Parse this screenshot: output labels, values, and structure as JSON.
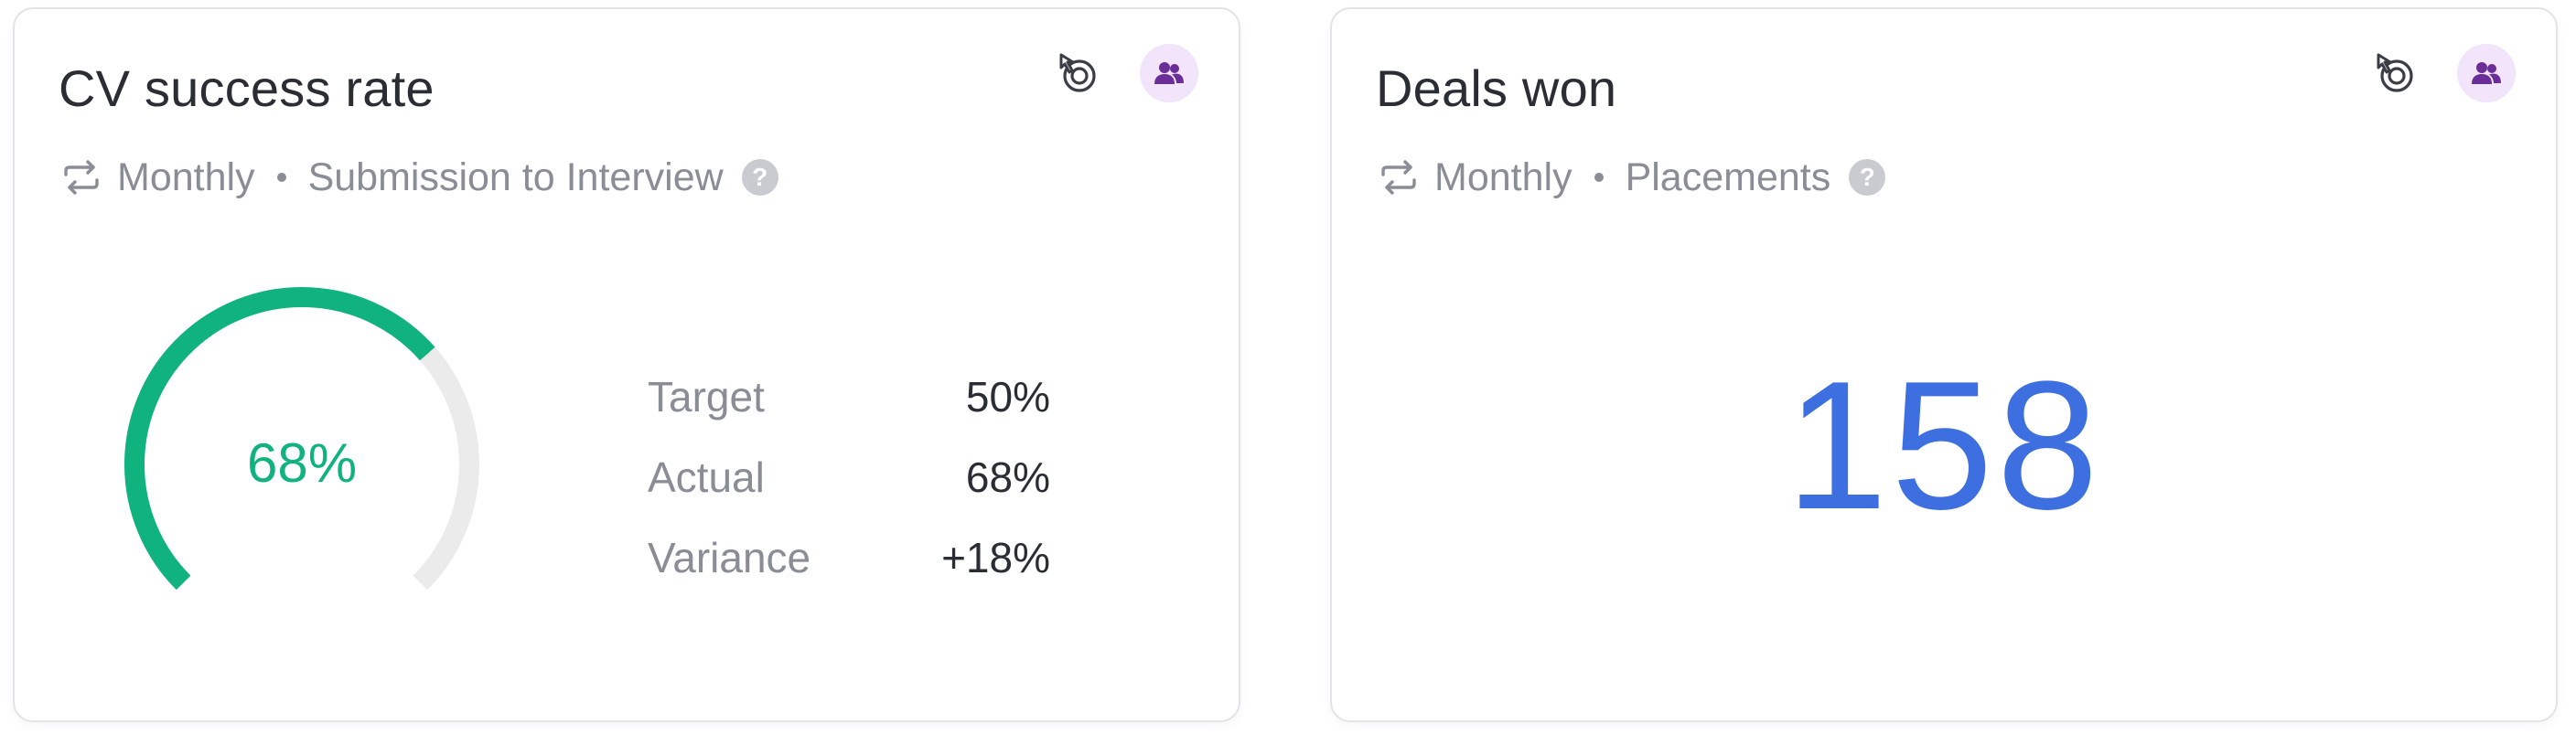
{
  "cards": [
    {
      "title": "CV success rate",
      "period": "Monthly",
      "stage": "Submission to Interview",
      "help_icon": "help-icon",
      "gauge": {
        "value": 68,
        "display": "68%",
        "color": "#10b37d",
        "track_color": "#ebebec"
      },
      "stats": [
        {
          "label": "Target",
          "value": "50%"
        },
        {
          "label": "Actual",
          "value": "68%"
        },
        {
          "label": "Variance",
          "value": "+18%"
        }
      ]
    },
    {
      "title": "Deals won",
      "period": "Monthly",
      "stage": "Placements",
      "help_icon": "help-icon",
      "metric": "158",
      "metric_color": "#3d6fe0"
    }
  ],
  "help_glyph": "?",
  "colors": {
    "muted_text": "#8a8d96",
    "primary_text": "#2a2d33",
    "avatar_bg": "#f1e4fb",
    "avatar_icon": "#6b2d97",
    "border": "#e3e4e8"
  }
}
